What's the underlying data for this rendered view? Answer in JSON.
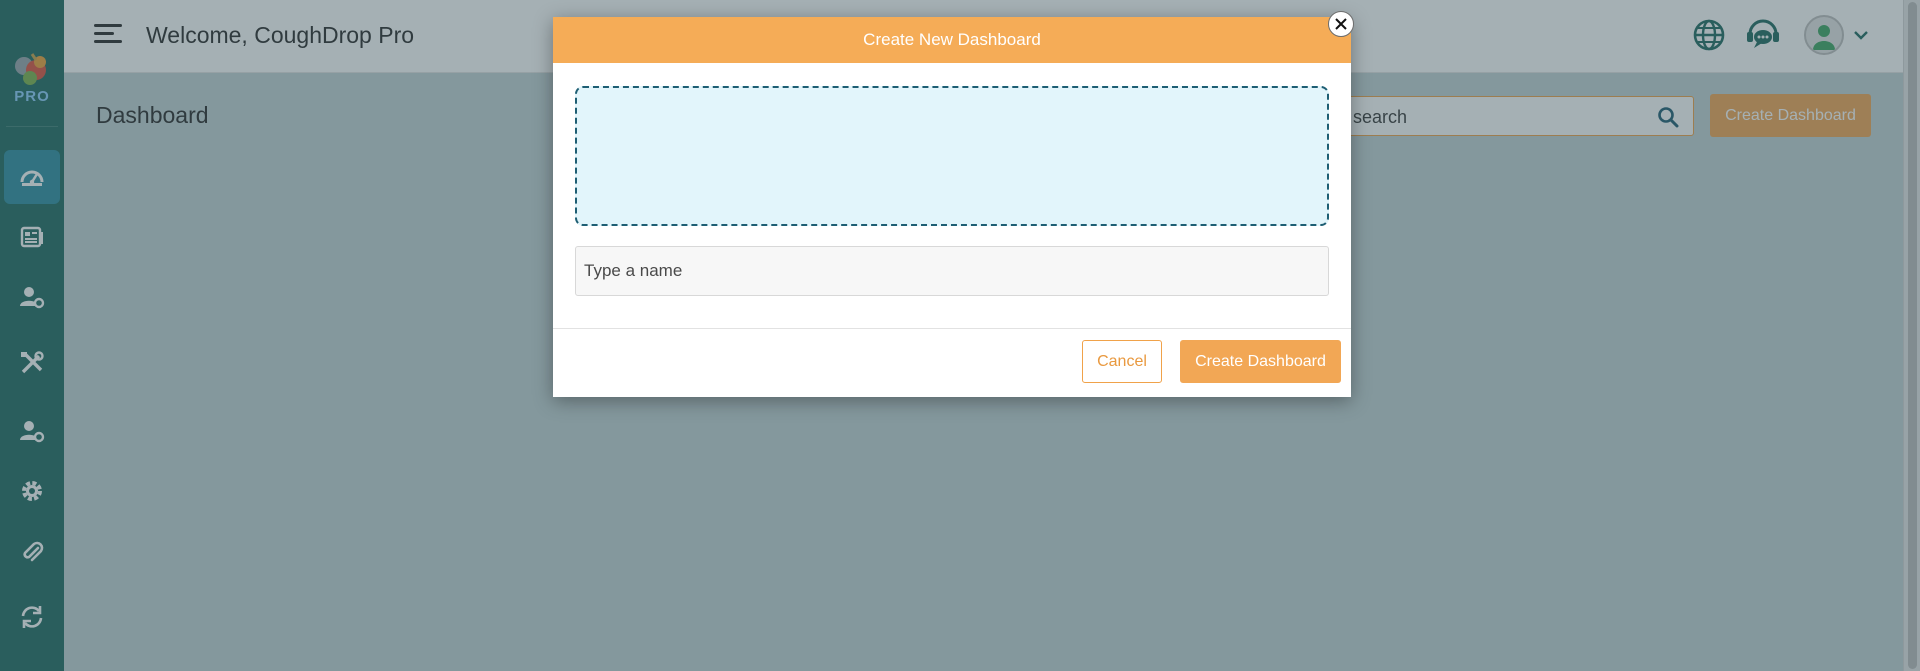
{
  "header": {
    "welcome_text": "Welcome, CoughDrop Pro",
    "menu_icon": "hamburger-icon",
    "icons": [
      "globe-icon",
      "support-chat-icon",
      "user-avatar-icon",
      "chevron-down-icon"
    ]
  },
  "sidebar": {
    "logo_text": "PRO",
    "items": [
      {
        "icon": "dashboard-gauge-icon",
        "active": true
      },
      {
        "icon": "reports-icon",
        "active": false
      },
      {
        "icon": "user-settings-icon",
        "active": false
      },
      {
        "icon": "tools-icon",
        "active": false
      },
      {
        "icon": "user-settings-icon",
        "active": false
      },
      {
        "icon": "gear-icon",
        "active": false
      },
      {
        "icon": "paperclip-icon",
        "active": false
      },
      {
        "icon": "sync-icon",
        "active": false
      }
    ]
  },
  "page": {
    "title": "Dashboard",
    "search_placeholder": "search",
    "create_button_label": "Create Dashboard"
  },
  "modal": {
    "title": "Create New Dashboard",
    "name_placeholder": "Type a name",
    "cancel_label": "Cancel",
    "create_label": "Create Dashboard"
  },
  "colors": {
    "sidebar": "#1f6b62",
    "accent": "#f2a755",
    "modal_header": "#f5ac57",
    "dropzone_fill": "#e2f5fb",
    "dropzone_border": "#1e5e73",
    "icon_teal": "#1f6b62"
  }
}
